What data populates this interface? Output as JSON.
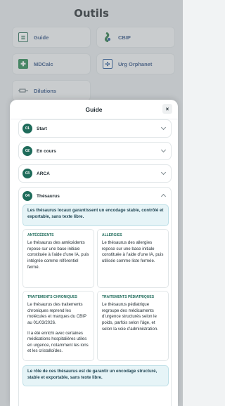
{
  "app": {
    "title": "Outils",
    "tiles": [
      {
        "label": "Guide",
        "icon": "document-icon",
        "color": "#2f6f5a"
      },
      {
        "label": "CBIP",
        "icon": "cbip-logo-icon",
        "color": "#2d7a4a"
      },
      {
        "label": "MDCalc",
        "icon": "plus-icon",
        "color": "#2e8b57"
      },
      {
        "label": "Urg Orphanet",
        "icon": "orphanet-icon",
        "color": "#2a5a9a"
      },
      {
        "label": "Dilutions",
        "icon": "syringe-icon",
        "color": "#5a6a70"
      }
    ]
  },
  "modal": {
    "title": "Guide",
    "close_label": "×",
    "sections": [
      {
        "num": "01",
        "label": "Start"
      },
      {
        "num": "02",
        "label": "En cours"
      },
      {
        "num": "03",
        "label": "ARCA"
      },
      {
        "num": "04",
        "label": "Thésaurus"
      }
    ],
    "thesaurus": {
      "intro": "Les thésaurus locaux garantissent un encodage stable, contrôlé et exportable, sans texte libre.",
      "cards": [
        {
          "heading": "ANTÉCÉDENTS",
          "text": "Le thésaurus des antécédents repose sur une base initiale constituée à l’aide d’une IA, puis intégrée comme référentiel fermé."
        },
        {
          "heading": "ALLERGIES",
          "text": "Le thésaurus des allergies repose sur une base initiale constituée à l’aide d’une IA, puis utilisée comme liste fermée."
        },
        {
          "heading": "TRAITEMENTS CHRONIQUES",
          "text": "Le thésaurus des traitements chroniques reprend les molécules et marques du CBIP au 01/03/2026.",
          "text2": "Il a été enrichi avec certaines médications hospitalières utiles en urgence, notamment les ions et les cristalloïdes."
        },
        {
          "heading": "TRAITEMENTS PÉDIATRIQUES",
          "text": "Le thésaurus pédiatrique regroupe des médicaments d’urgence structurés selon le poids, parfois selon l’âge, et selon la voie d’administration."
        }
      ],
      "footer": "Le rôle de ces thésaurus est de garantir un encodage structuré, stable et exportable, sans texte libre."
    }
  }
}
